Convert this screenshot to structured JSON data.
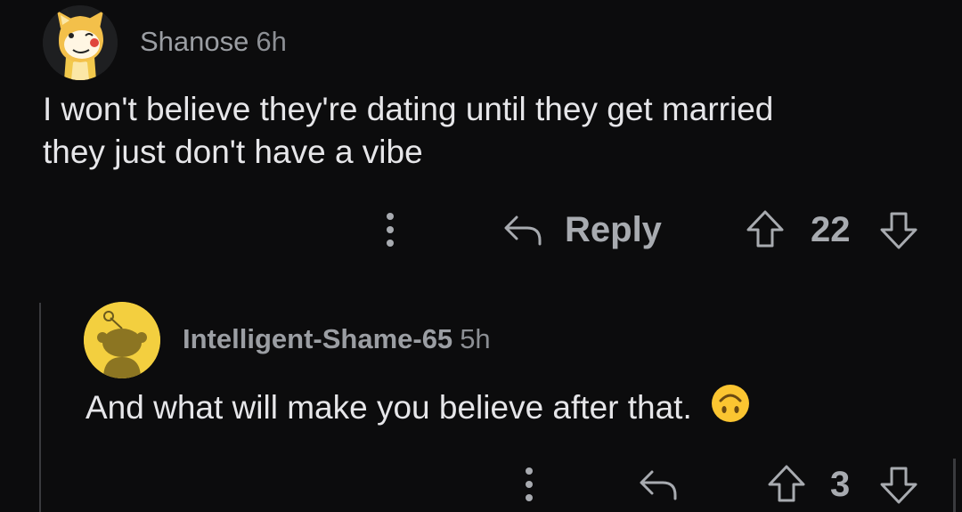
{
  "comments": [
    {
      "author": "Shanose",
      "time": "6h",
      "body_lines": [
        "I won't believe they're dating until they get married",
        "they just don't have a vibe"
      ],
      "reply_label": "Reply",
      "vote_count": "22",
      "avatar_icon": "shiba-snoo-avatar-icon"
    },
    {
      "author": "Intelligent-Shame-65",
      "time": "5h",
      "body": "And what will make you believe after that.",
      "emoji": "upside-down-face-emoji-icon",
      "vote_count": "3",
      "avatar_icon": "default-snoo-avatar-icon"
    }
  ],
  "colors": {
    "background": "#0c0c0d",
    "text": "#e6e6e9",
    "muted": "#9b9ea3",
    "avatar_yellow": "#f3cf3f",
    "thread_line": "#3a3b3e"
  }
}
